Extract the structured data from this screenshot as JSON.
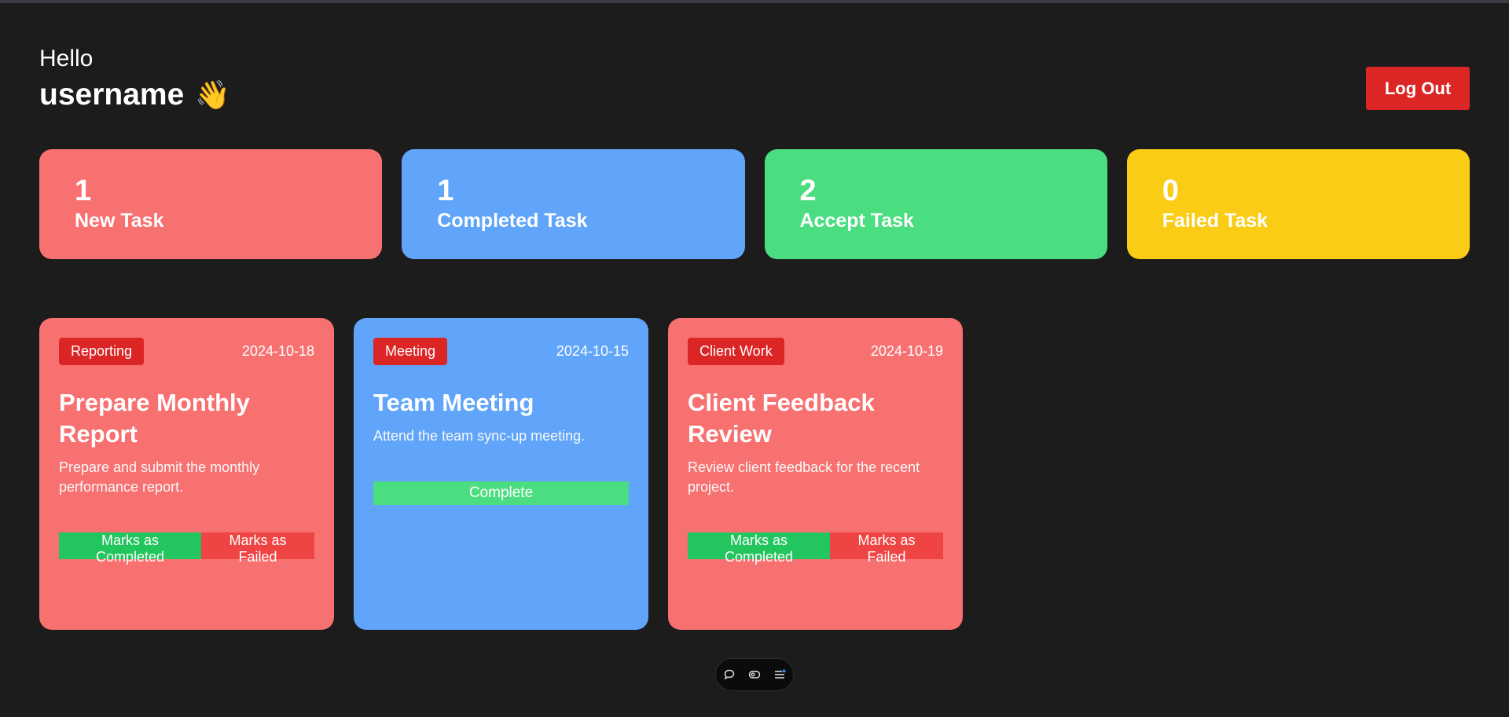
{
  "header": {
    "greeting": "Hello",
    "username": "username",
    "wave_emoji": "👋",
    "logout_label": "Log Out"
  },
  "stats": [
    {
      "count": "1",
      "label": "New Task",
      "color": "#f87171"
    },
    {
      "count": "1",
      "label": "Completed Task",
      "color": "#60a5fa"
    },
    {
      "count": "2",
      "label": "Accept Task",
      "color": "#4ade80"
    },
    {
      "count": "0",
      "label": "Failed Task",
      "color": "#facc15"
    }
  ],
  "tasks": [
    {
      "category": "Reporting",
      "date": "2024-10-18",
      "title": "Prepare Monthly Report",
      "description": "Prepare and submit the monthly performance report.",
      "color": "#f87171",
      "actions": {
        "completed": "Marks as Completed",
        "failed": "Marks as Failed"
      }
    },
    {
      "category": "Meeting",
      "date": "2024-10-15",
      "title": "Team Meeting",
      "description": "Attend the team sync-up meeting.",
      "color": "#60a5fa",
      "status_button": "Complete"
    },
    {
      "category": "Client Work",
      "date": "2024-10-19",
      "title": "Client Feedback Review",
      "description": "Review client feedback for the recent project.",
      "color": "#f87171",
      "actions": {
        "completed": "Marks as Completed",
        "failed": "Marks as Failed"
      }
    }
  ],
  "devbar": {
    "icons": [
      "chat-icon",
      "eye-icon",
      "menu-icon"
    ]
  },
  "colors": {
    "background": "#1c1c1c",
    "danger": "#dc2626",
    "success": "#22c55e"
  }
}
